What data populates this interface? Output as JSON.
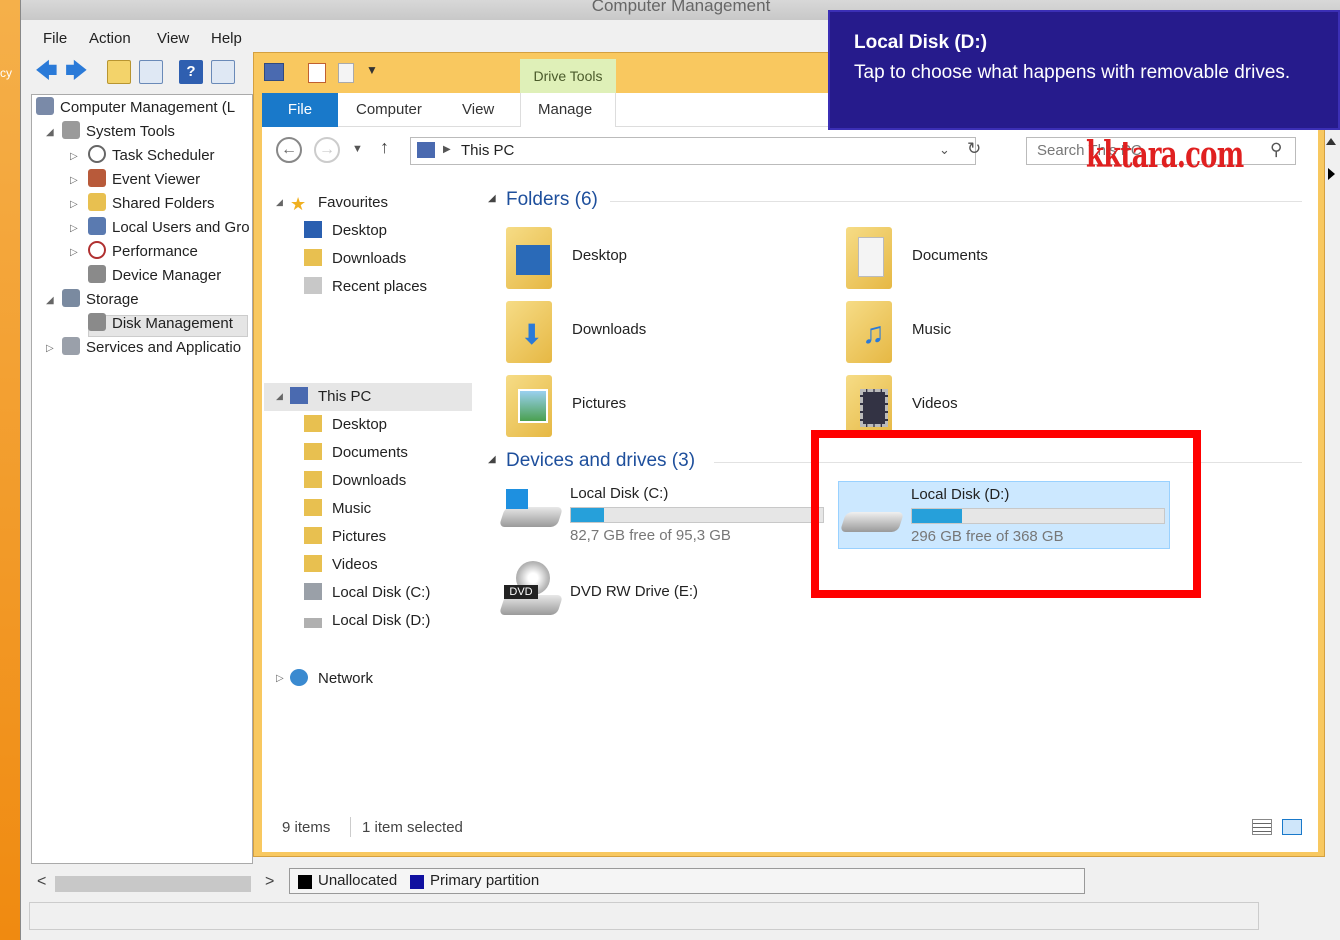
{
  "desktop": {
    "edge_label": "cy"
  },
  "cm": {
    "title": "Computer Management",
    "menu": [
      "File",
      "Action",
      "View",
      "Help"
    ],
    "tree": {
      "root": "Computer Management (L",
      "system_tools": "System Tools",
      "task_scheduler": "Task Scheduler",
      "event_viewer": "Event Viewer",
      "shared_folders": "Shared Folders",
      "local_users": "Local Users and Gro",
      "performance": "Performance",
      "device_manager": "Device Manager",
      "storage": "Storage",
      "disk_management": "Disk Management",
      "services": "Services and Applicatio"
    },
    "legend": {
      "unallocated": "Unallocated",
      "primary": "Primary partition",
      "unallocated_color": "#000000",
      "primary_color": "#1010a0"
    },
    "scroll_left": "<",
    "scroll_right": ">"
  },
  "explorer": {
    "contextual_tab": "Drive Tools",
    "tabs": {
      "file": "File",
      "computer": "Computer",
      "view": "View",
      "manage": "Manage"
    },
    "address": {
      "crumb": "This PC"
    },
    "search": {
      "placeholder": "Search This PC"
    },
    "nav": {
      "favourites": "Favourites",
      "fav_desktop": "Desktop",
      "fav_downloads": "Downloads",
      "fav_recent": "Recent places",
      "this_pc": "This PC",
      "pc_desktop": "Desktop",
      "pc_documents": "Documents",
      "pc_downloads": "Downloads",
      "pc_music": "Music",
      "pc_pictures": "Pictures",
      "pc_videos": "Videos",
      "pc_local_c": "Local Disk (C:)",
      "pc_local_d": "Local Disk (D:)",
      "network": "Network"
    },
    "folders_header": "Folders (6)",
    "folders": [
      "Desktop",
      "Documents",
      "Downloads",
      "Music",
      "Pictures",
      "Videos"
    ],
    "devices_header": "Devices and drives (3)",
    "drives": {
      "c": {
        "name": "Local Disk (C:)",
        "free": "82,7 GB free of 95,3 GB",
        "used_fraction": 0.13
      },
      "d": {
        "name": "Local Disk (D:)",
        "free": "296 GB free of 368 GB",
        "used_fraction": 0.2
      },
      "e": {
        "name": "DVD RW Drive (E:)",
        "badge": "DVD"
      }
    },
    "status": {
      "items": "9 items",
      "selected": "1 item selected"
    },
    "accent": "#1979ca"
  },
  "toast": {
    "title": "Local Disk (D:)",
    "body": "Tap to choose what happens with removable drives."
  },
  "watermark": "kktara.com"
}
